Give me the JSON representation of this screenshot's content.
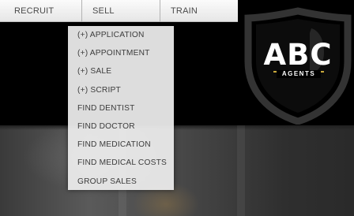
{
  "nav": {
    "items": [
      {
        "label": "RECRUIT"
      },
      {
        "label": "SELL"
      },
      {
        "label": "TRAIN"
      }
    ]
  },
  "dropdown": {
    "items": [
      {
        "label": "(+) APPLICATION"
      },
      {
        "label": "(+) APPOINTMENT"
      },
      {
        "label": "(+) SALE"
      },
      {
        "label": "(+) SCRIPT"
      },
      {
        "label": "FIND DENTIST"
      },
      {
        "label": "FIND DOCTOR"
      },
      {
        "label": "FIND MEDICATION"
      },
      {
        "label": "FIND MEDICAL COSTS"
      },
      {
        "label": "GROUP SALES"
      }
    ]
  },
  "logo": {
    "brand": "ABC",
    "subtitle": "AGENTS"
  },
  "colors": {
    "background": "#000000",
    "nav_bg": "#efefef",
    "nav_text": "#4a4a4a",
    "dropdown_bg": "#eeeeee",
    "dropdown_text": "#3c3c3c",
    "logo_accent": "#c9a93c"
  }
}
